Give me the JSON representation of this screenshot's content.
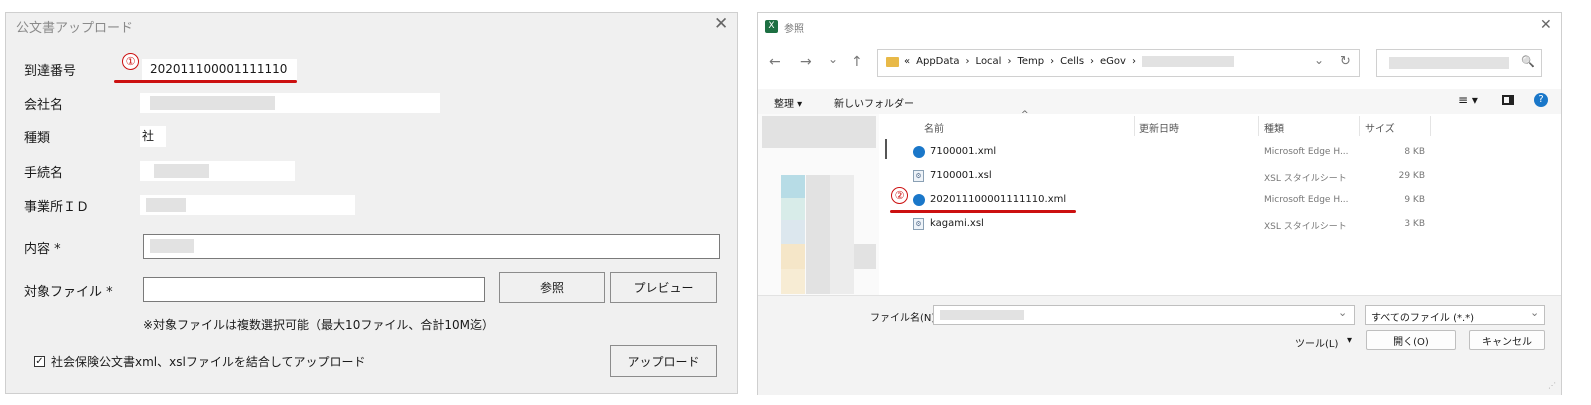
{
  "left_dialog": {
    "title": "公文書アップロード",
    "close_glyph": "✕",
    "fields": {
      "arrival_no": {
        "label": "到達番号",
        "value": "202011100001111110"
      },
      "company": {
        "label": "会社名"
      },
      "type": {
        "label": "種類",
        "value": "社"
      },
      "procedure": {
        "label": "手続名"
      },
      "office_id": {
        "label": "事業所ＩＤ"
      },
      "content": {
        "label": "内容 *"
      },
      "target_file": {
        "label": "対象ファイル *"
      }
    },
    "browse_button": "参照",
    "preview_button": "プレビュー",
    "note": "※対象ファイルは複数選択可能（最大10ファイル、合計10M迄）",
    "merge_checkbox": {
      "checked_glyph": "✓",
      "label": "社会保険公文書xml、xslファイルを結合してアップロード"
    },
    "upload_button": "アップロード",
    "annotation": "①"
  },
  "file_dialog": {
    "title": "参照",
    "close_glyph": "✕",
    "nav": {
      "back": "←",
      "forward": "→",
      "recent": "⌄",
      "up": "↑",
      "refresh": "↻"
    },
    "breadcrumb": {
      "prefix": "«",
      "items": [
        "AppData",
        "Local",
        "Temp",
        "Cells",
        "eGov"
      ],
      "separator": "›",
      "chevron": "⌄"
    },
    "search_glyph": "🔍",
    "toolbar": {
      "organize": "整理 ▾",
      "new_folder": "新しいフォルダー",
      "view_glyph": "≡ ▾",
      "help_glyph": "?"
    },
    "columns": {
      "name": "名前",
      "modified": "更新日時",
      "type": "種類",
      "size": "サイズ",
      "sort_glyph": "^"
    },
    "files": [
      {
        "name": "7100001.xml",
        "icon": "edge-icon",
        "type": "Microsoft Edge H...",
        "size": "8 KB"
      },
      {
        "name": "7100001.xsl",
        "icon": "xsl-file-icon",
        "type": "XSL スタイルシート",
        "size": "29 KB"
      },
      {
        "name": "202011100001111110.xml",
        "icon": "edge-icon",
        "type": "Microsoft Edge H...",
        "size": "9 KB"
      },
      {
        "name": "kagami.xsl",
        "icon": "xsl-file-icon",
        "type": "XSL スタイルシート",
        "size": "3 KB"
      }
    ],
    "filename_label": "ファイル名(N):",
    "filetype_select": "すべてのファイル (*.*)",
    "tools": "ツール(L)",
    "tools_caret": "▾",
    "open_button": "開く(O)",
    "cancel_button": "キャンセル",
    "annotation": "②"
  },
  "colors": {
    "annotation_red": "#cc1010",
    "excel_green": "#1d6f42",
    "folder_yellow": "#e8b948",
    "help_blue": "#1a77c9"
  }
}
